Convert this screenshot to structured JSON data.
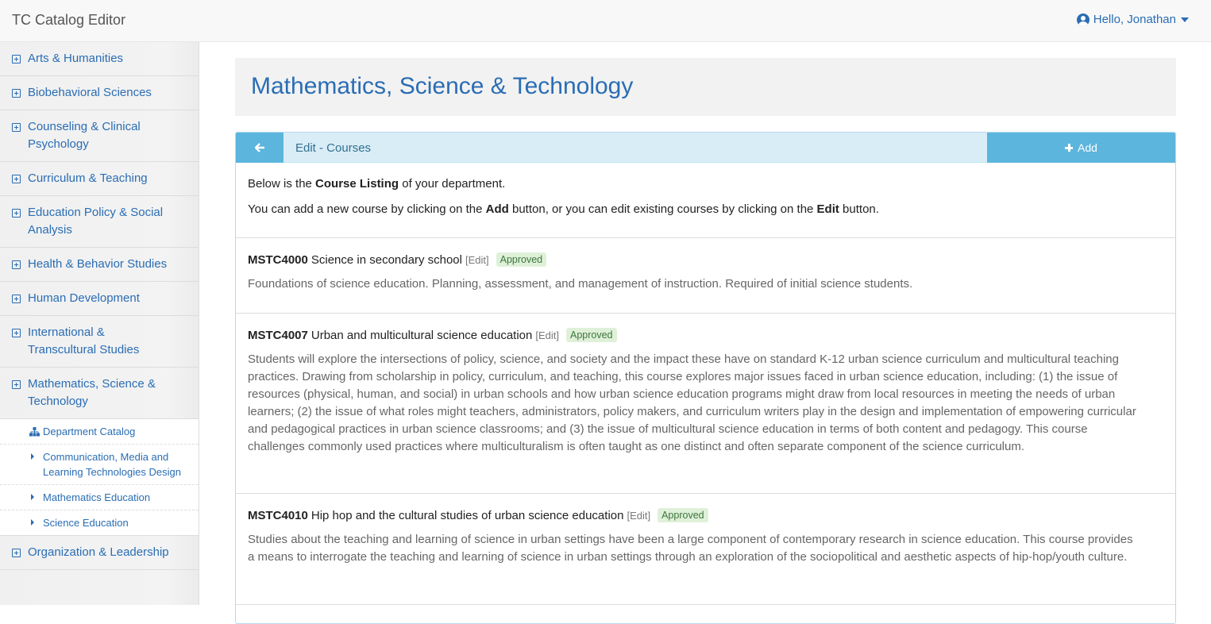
{
  "app": {
    "title": "TC Catalog Editor",
    "user_greeting": "Hello, Jonathan"
  },
  "sidebar": {
    "items": [
      {
        "label": "Arts & Humanities"
      },
      {
        "label": "Biobehavioral Sciences"
      },
      {
        "label": "Counseling & Clinical Psychology"
      },
      {
        "label": "Curriculum & Teaching"
      },
      {
        "label": "Education Policy & Social Analysis"
      },
      {
        "label": "Health & Behavior Studies"
      },
      {
        "label": "Human Development"
      },
      {
        "label": "International & Transcultural Studies"
      },
      {
        "label": "Mathematics, Science & Technology"
      },
      {
        "label": "Organization & Leadership"
      }
    ],
    "subitems": [
      {
        "label": "Department Catalog"
      },
      {
        "label": "Communication, Media and Learning Technologies Design"
      },
      {
        "label": "Mathematics Education"
      },
      {
        "label": "Science Education"
      }
    ]
  },
  "page": {
    "heading": "Mathematics, Science & Technology",
    "panel_title": "Edit - Courses",
    "add_label": "Add",
    "intro": {
      "line1_pre": "Below is the ",
      "line1_bold": "Course Listing",
      "line1_post": " of your department.",
      "line2_pre": "You can add a new course by clicking on the ",
      "line2_bold1": "Add",
      "line2_mid": " button, or you can edit existing courses by clicking on the ",
      "line2_bold2": "Edit",
      "line2_post": " button."
    },
    "courses": [
      {
        "code": "MSTC4000",
        "title": "Science in secondary school",
        "edit": "[Edit]",
        "status": "Approved",
        "description": "Foundations of science education. Planning, assessment, and management of instruction. Required of initial science students."
      },
      {
        "code": "MSTC4007",
        "title": "Urban and multicultural science education",
        "edit": "[Edit]",
        "status": "Approved",
        "description": "Students will explore the intersections of policy, science, and society and the impact these have on standard K-12 urban science curriculum and multicultural teaching practices. Drawing from scholarship in policy, curriculum, and teaching, this course explores major issues faced in urban science education, including: (1) the issue of resources (physical, human, and social) in urban schools and how urban science education programs might draw from local resources in meeting the needs of urban learners; (2) the issue of what roles might teachers, administrators, policy makers, and curriculum writers play in the design and implementation of empowering curricular and pedagogical practices in urban science classrooms; and (3) the issue of multicultural science education in terms of both content and pedagogy. This course challenges commonly used practices where multiculturalism is often taught as one distinct and often separate component of the science curriculum."
      },
      {
        "code": "MSTC4010",
        "title": "Hip hop and the cultural studies of urban science education",
        "edit": "[Edit]",
        "status": "Approved",
        "description": "Studies about the teaching and learning of science in urban settings have been a large component of contemporary research in science education.  This course provides a means to interrogate the teaching and learning of science in urban settings through an exploration of the sociopolitical and aesthetic aspects of hip-hop/youth culture."
      }
    ]
  }
}
